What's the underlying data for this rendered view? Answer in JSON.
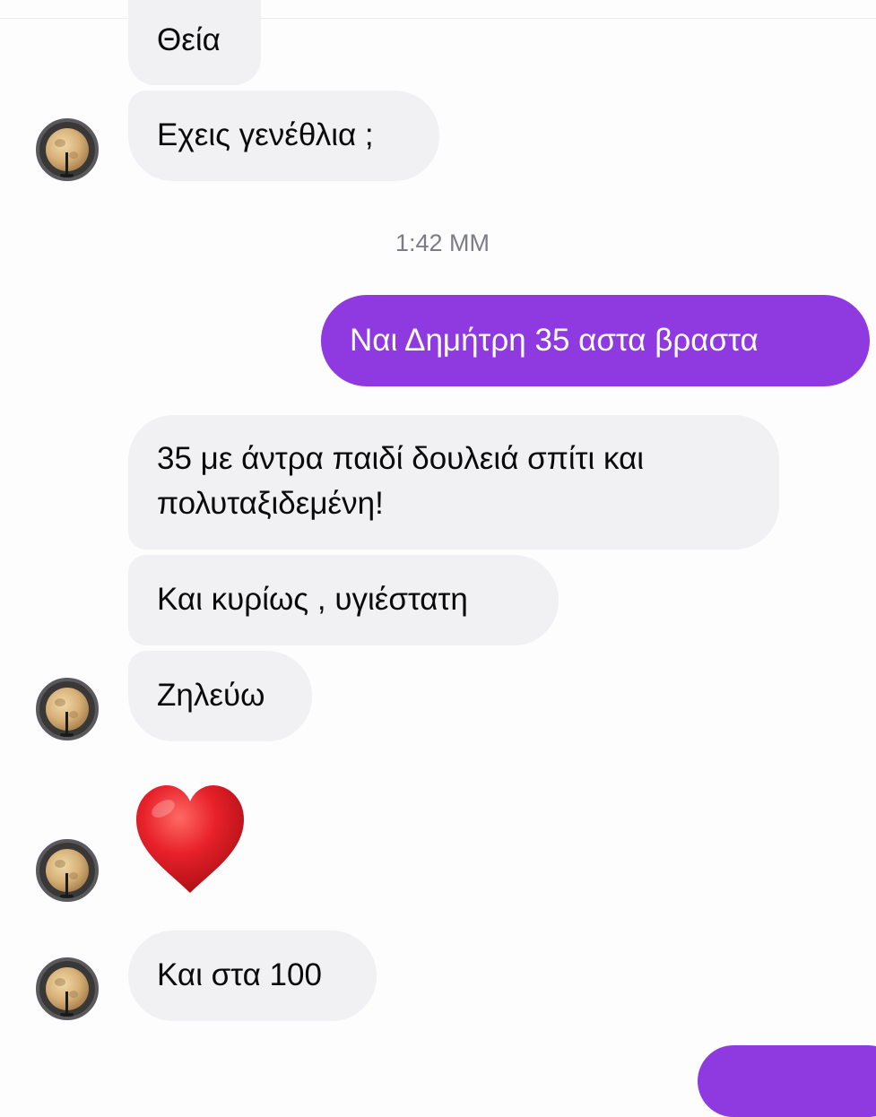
{
  "conversation": {
    "messages": [
      {
        "text": "Θεία"
      },
      {
        "text": "Εχεις γενέθλια ;"
      },
      {
        "text": "Ναι Δημήτρη 35 αστα βραστα"
      },
      {
        "text_line1": "35 με άντρα παιδί δουλειά σπίτι και",
        "text_line2": "πολυταξιδεμένη!"
      },
      {
        "text": "Και κυρίως , υγιέστατη"
      },
      {
        "text": "Ζηλεύω"
      },
      {
        "emoji": "❤️"
      },
      {
        "text": "Και στα 100"
      }
    ],
    "timestamp": "1:42 ΜΜ"
  },
  "colors": {
    "outgoing_bubble": "#8e3ae0",
    "incoming_bubble": "#f1f1f4",
    "timestamp_text": "#7c7c84",
    "background": "#fdfdfe"
  },
  "icons": {
    "avatar": "moon-photo-avatar",
    "reaction": "red-heart-emoji"
  }
}
